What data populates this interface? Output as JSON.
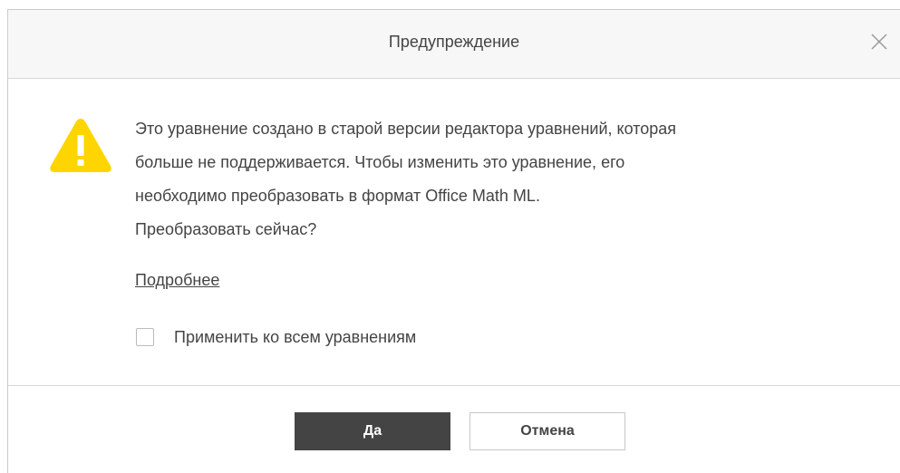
{
  "dialog": {
    "title": "Предупреждение",
    "close_icon": "close-icon",
    "warning_icon": "warning-triangle-icon",
    "message_lines": [
      "Это уравнение создано в старой версии редактора уравнений, которая",
      "больше не поддерживается. Чтобы изменить это уравнение, его",
      "необходимо преобразовать в формат Office Math ML.",
      "Преобразовать сейчас?"
    ],
    "more_link": "Подробнее",
    "checkbox_label": "Применить ко всем уравнениям",
    "checkbox_checked": false,
    "ok_label": "Да",
    "cancel_label": "Отмена"
  },
  "colors": {
    "warning": "#FFD500",
    "primary_button": "#444444",
    "text": "#444444"
  }
}
